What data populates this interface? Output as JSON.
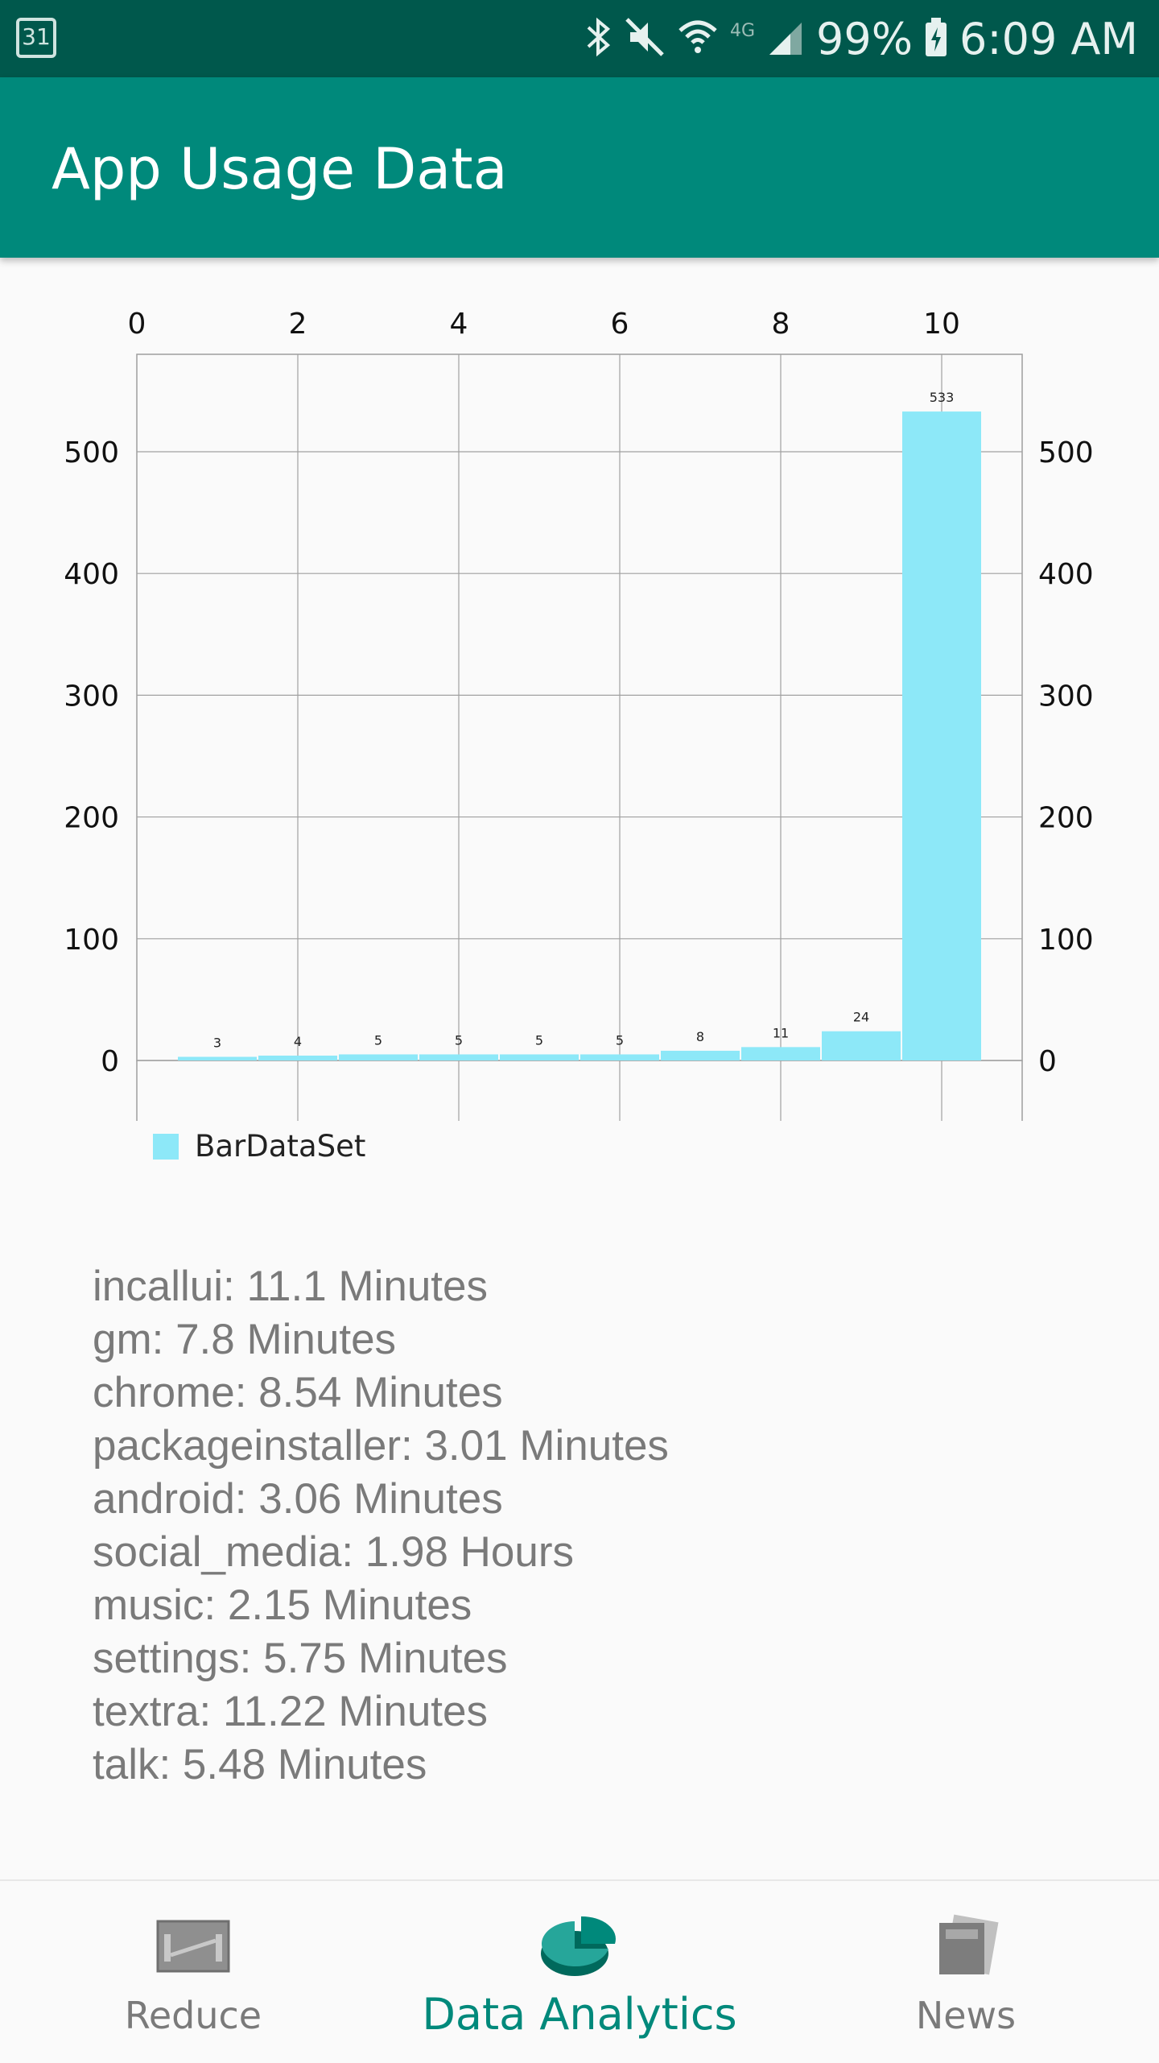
{
  "status_bar": {
    "calendar_day": "31",
    "battery": "99%",
    "time": "6:09 AM",
    "network": "4G",
    "icons": [
      "calendar-icon",
      "bluetooth-icon",
      "mute-icon",
      "wifi-icon",
      "signal-icon",
      "battery-icon"
    ]
  },
  "app_bar": {
    "title": "App Usage Data"
  },
  "colors": {
    "primary": "#00897b",
    "primary_dark": "#00584c",
    "bar": "#8de8f8"
  },
  "chart_data": {
    "type": "bar",
    "x": [
      1,
      2,
      3,
      4,
      5,
      6,
      7,
      8,
      9,
      10
    ],
    "values": [
      3,
      4,
      5,
      5,
      5,
      5,
      8,
      11,
      24,
      533
    ],
    "value_labels": [
      "3",
      "4",
      "5",
      "5",
      "5",
      "5",
      "8",
      "11",
      "24",
      "533"
    ],
    "x_ticks": [
      "0",
      "2",
      "4",
      "6",
      "8",
      "10"
    ],
    "y_ticks_left": [
      "0",
      "100",
      "200",
      "300",
      "400",
      "500"
    ],
    "y_ticks_right": [
      "0",
      "100",
      "200",
      "300",
      "400",
      "500"
    ],
    "xlim": [
      0,
      11
    ],
    "ylim": [
      0,
      580
    ],
    "x_axis_position": "top",
    "grid": true,
    "legend": {
      "label": "BarDataSet",
      "position": "bottom-left"
    }
  },
  "usage_list": [
    "incallui: 11.1 Minutes",
    "gm: 7.8 Minutes",
    "chrome: 8.54 Minutes",
    "packageinstaller: 3.01 Minutes",
    "android: 3.06 Minutes",
    "social_media: 1.98 Hours",
    "music: 2.15 Minutes",
    "settings: 5.75 Minutes",
    "textra: 11.22 Minutes",
    "talk: 5.48 Minutes"
  ],
  "bottom_nav": {
    "items": [
      {
        "label": "Reduce",
        "icon": "dumbbell-icon",
        "active": false
      },
      {
        "label": "Data Analytics",
        "icon": "pie-chart-icon",
        "active": true
      },
      {
        "label": "News",
        "icon": "newspaper-icon",
        "active": false
      }
    ]
  }
}
